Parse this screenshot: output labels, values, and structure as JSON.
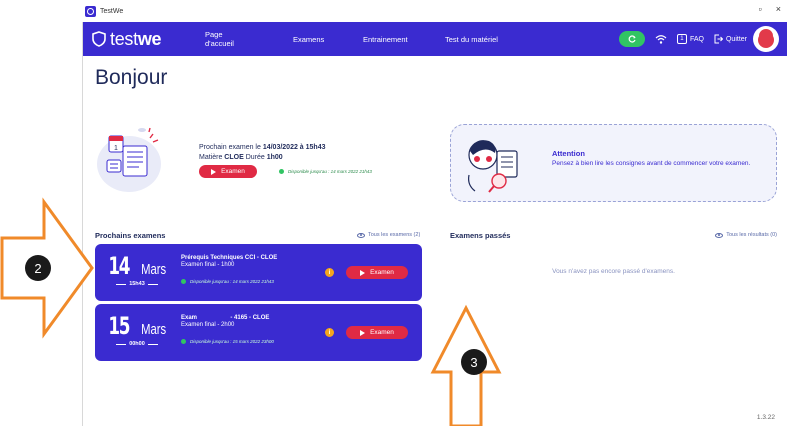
{
  "window": {
    "title": "TestWe",
    "minimize": "▫",
    "close": "×"
  },
  "navbar": {
    "brand_light": "test",
    "brand_bold": "we",
    "links": [
      "Page d'accueil",
      "Examens",
      "Entrainement",
      "Test du matériel"
    ],
    "faq_num": "1",
    "faq_label": "FAQ",
    "quit_label": "Quitter"
  },
  "greeting": "Bonjour",
  "next_exam": {
    "line1_prefix": "Prochain examen le ",
    "line1_date": "14/03/2022 à 15h43",
    "line2_prefix": "Matière ",
    "line2_subject": "CLOE",
    "line2_mid": " Durée ",
    "line2_duration": "1h00",
    "button": "Examen",
    "availability": "Disponible jusqu'au : 14 mars 2022 21h43"
  },
  "attention": {
    "title": "Attention",
    "body": "Pensez à bien lire les consignes avant de commencer votre examen."
  },
  "upcoming": {
    "title": "Prochains examens",
    "link": "Tous les examens (2)",
    "cards": [
      {
        "day": "14",
        "month": "Mars",
        "time": "15h43",
        "title": "Prérequis Techniques CCI - CLOE",
        "subtitle": "Examen final - 1h00",
        "availability": "Disponible jusqu'au : 14 mars 2022 21h43",
        "info": "i",
        "button": "Examen"
      },
      {
        "day": "15",
        "month": "Mars",
        "time": "00h00",
        "title": "Exam                    - 4165 - CLOE",
        "subtitle": "Examen final - 2h00",
        "availability": "Disponible jusqu'au : 15 mars 2022 23h00",
        "info": "i",
        "button": "Examen"
      }
    ]
  },
  "past": {
    "title": "Examens passés",
    "link": "Tous les résultats (0)",
    "empty": "Vous n'avez pas encore passé d'examens."
  },
  "version": "1.3.22",
  "annotations": [
    "2",
    "3"
  ],
  "colors": {
    "primary": "#3a2bd0",
    "accent": "#e02a44",
    "success": "#31c463",
    "arrow": "#f08a2a"
  }
}
